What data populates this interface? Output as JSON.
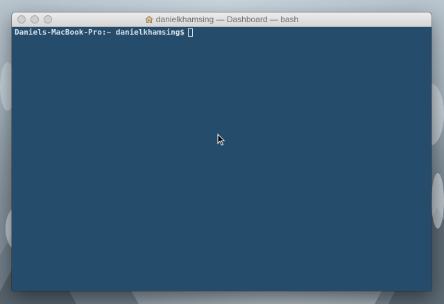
{
  "window": {
    "title": "danielkhamsing — Dashboard — bash",
    "title_icon": "home-icon",
    "traffic_lights": [
      "close",
      "minimize",
      "zoom"
    ]
  },
  "terminal": {
    "prompt": "Daniels-MacBook-Pro:~ danielkhamsing$",
    "input": "",
    "background_color": "#254c6b",
    "text_color": "#d9e2e8"
  },
  "pointer": {
    "icon": "arrow-pointer-icon"
  }
}
